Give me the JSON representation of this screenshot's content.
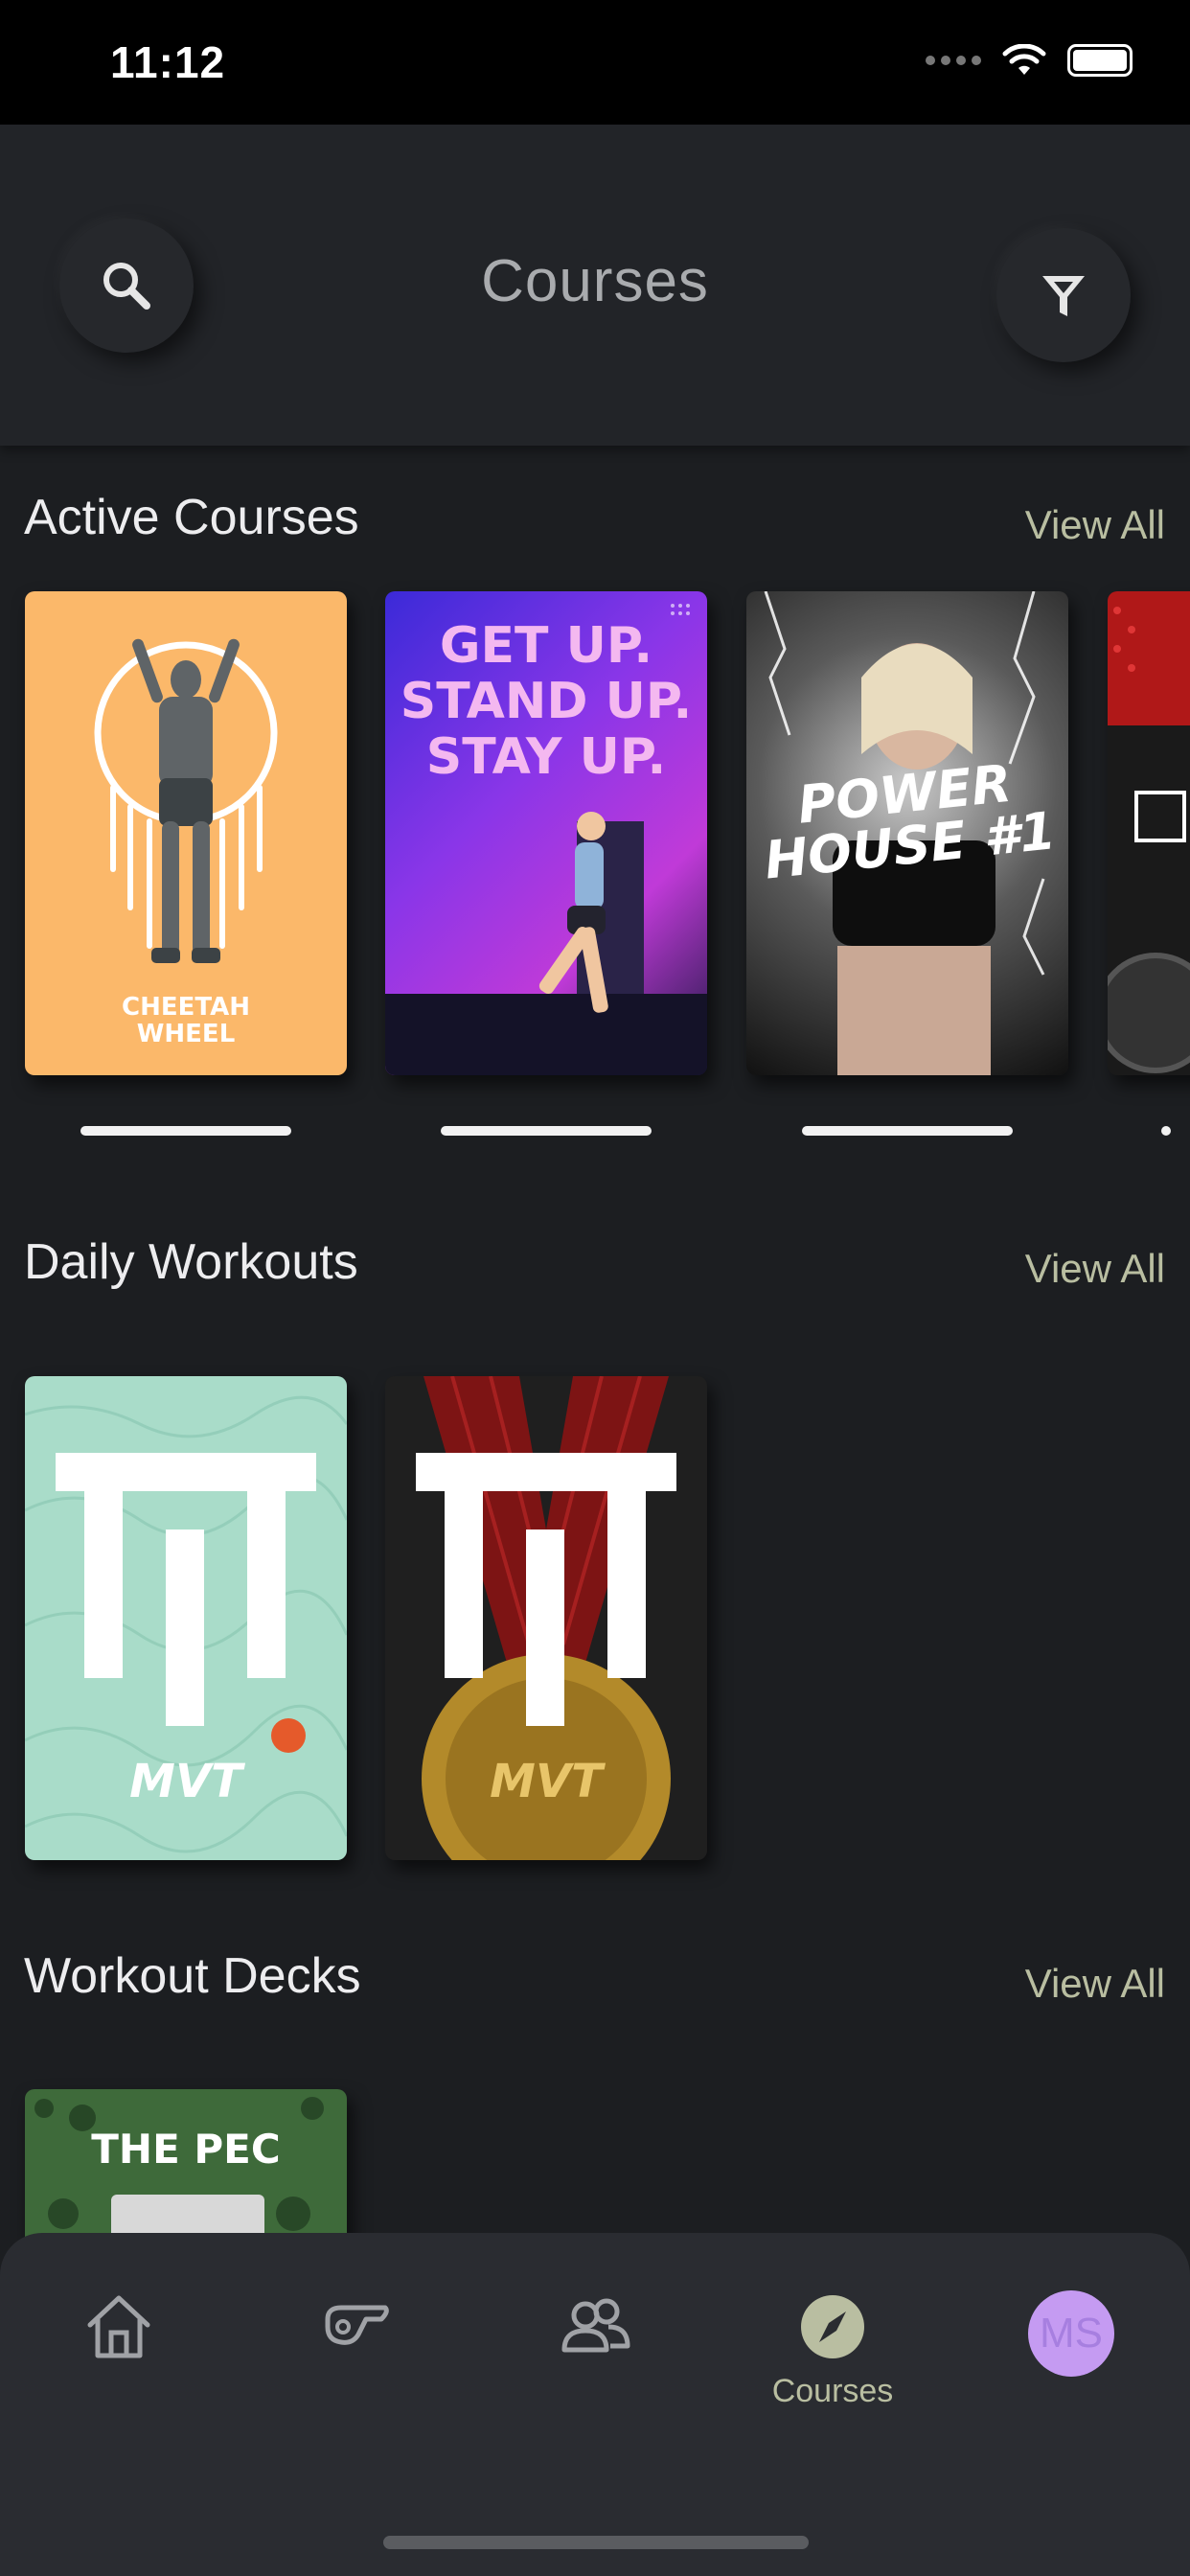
{
  "status_bar": {
    "time": "11:12"
  },
  "header": {
    "title": "Courses"
  },
  "sections": {
    "active": {
      "title": "Active Courses",
      "view_all": "View All",
      "cards": [
        {
          "title": "CHEETAH\nWHEEL",
          "progress": 1.0
        },
        {
          "title": "GET UP.\nSTAND UP.\nSTAY UP.",
          "progress": 1.0
        },
        {
          "title": "POWER\nHOUSE #1",
          "progress": 1.0
        }
      ]
    },
    "daily": {
      "title": "Daily Workouts",
      "view_all": "View All",
      "cards": [
        {
          "brand": "MVT"
        },
        {
          "brand": "MVT"
        }
      ]
    },
    "decks": {
      "title": "Workout Decks",
      "view_all": "View All",
      "cards": [
        {
          "title": "THE PEC"
        }
      ]
    }
  },
  "bottom_nav": {
    "items": [
      {
        "icon": "home-icon"
      },
      {
        "icon": "whistle-icon"
      },
      {
        "icon": "community-icon"
      },
      {
        "icon": "compass-icon",
        "label": "Courses"
      },
      {
        "icon": "avatar",
        "initials": "MS"
      }
    ],
    "active_color": "#b9bea1"
  },
  "colors": {
    "background": "#1c1e21",
    "accent": "#b9bea1",
    "avatar": "#c59bf2"
  }
}
